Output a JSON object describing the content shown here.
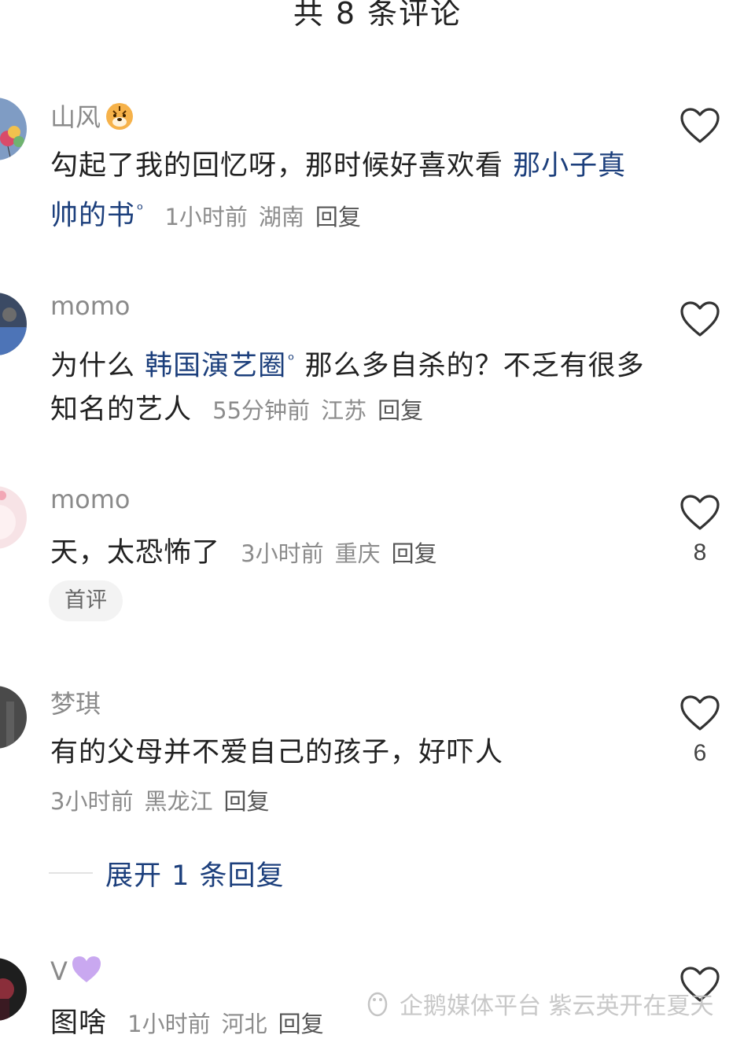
{
  "header": {
    "title": "共 8 条评论"
  },
  "comments": [
    {
      "username": "山风",
      "username_emoji": "tiger-face-icon",
      "text_before": "勾起了我的回忆呀，那时候好喜欢看 ",
      "topic": "那小子真帅的书",
      "text_after": "",
      "time": "1小时前",
      "location": "湖南",
      "reply": "回复",
      "likes": ""
    },
    {
      "username": "momo",
      "text_before": "为什么 ",
      "topic": "韩国演艺圈",
      "text_after": " 那么多自杀的？不乏有很多知名的艺人",
      "time": "55分钟前",
      "location": "江苏",
      "reply": "回复",
      "likes": ""
    },
    {
      "username": "momo",
      "text_before": "天，太恐怖了",
      "time": "3小时前",
      "location": "重庆",
      "reply": "回复",
      "likes": "8",
      "badge": "首评"
    },
    {
      "username": "梦琪",
      "text_before": "有的父母并不爱自己的孩子，好吓人",
      "time": "3小时前",
      "location": "黑龙江",
      "reply": "回复",
      "likes": "6",
      "expand_label": "展开 1 条回复"
    },
    {
      "username": "V",
      "username_emoji": "purple-heart-icon",
      "text_before": "图啥",
      "time": "1小时前",
      "location": "河北",
      "reply": "回复",
      "likes": ""
    }
  ],
  "watermark": {
    "text": "企鹅媒体平台 紫云英开在夏天",
    "icon": "penguin-icon"
  },
  "colors": {
    "topic_link": "#1c3f7c",
    "meta_text": "#8c8c8c",
    "username": "#8a8a8a"
  }
}
